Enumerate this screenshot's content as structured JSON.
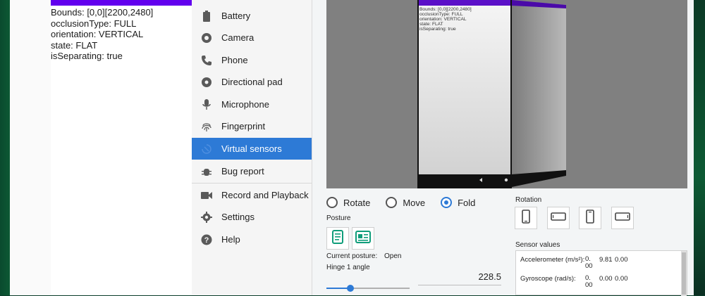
{
  "device_info": {
    "lines": [
      "Bounds: [0,0][2200,2480]",
      "occlusionType: FULL",
      "orientation: VERTICAL",
      "state: FLAT",
      "isSeparating: true"
    ]
  },
  "preview": {
    "lines": [
      "Bounds: [0,0][2200,2480]",
      "occlusionType: FULL",
      "orientation: VERTICAL",
      "state: FLAT",
      "isSeparating: true"
    ]
  },
  "nav": {
    "items": [
      {
        "label": "Battery",
        "icon": "battery-icon"
      },
      {
        "label": "Camera",
        "icon": "camera-icon"
      },
      {
        "label": "Phone",
        "icon": "phone-icon"
      },
      {
        "label": "Directional pad",
        "icon": "dpad-icon"
      },
      {
        "label": "Microphone",
        "icon": "microphone-icon"
      },
      {
        "label": "Fingerprint",
        "icon": "fingerprint-icon"
      },
      {
        "label": "Virtual sensors",
        "icon": "virtual-sensors-icon",
        "active": true
      },
      {
        "label": "Bug report",
        "icon": "bug-icon"
      },
      {
        "label": "Record and Playback",
        "icon": "video-icon"
      },
      {
        "label": "Settings",
        "icon": "gear-icon"
      },
      {
        "label": "Help",
        "icon": "help-icon"
      }
    ]
  },
  "mode": {
    "options": [
      "Rotate",
      "Move",
      "Fold"
    ],
    "selected": "Fold"
  },
  "posture": {
    "label": "Posture",
    "current_label": "Current posture:",
    "current_value": "Open"
  },
  "hinge": {
    "label": "Hinge 1 angle",
    "value": "228.5",
    "slider_fraction": 0.29
  },
  "rotation": {
    "label": "Rotation"
  },
  "sensors": {
    "label": "Sensor values",
    "rows": [
      {
        "name": "Accelerometer (m/s²):",
        "values": [
          "0.\n00",
          "9.81",
          "0.00"
        ]
      },
      {
        "name": "Gyroscope (rad/s):",
        "values": [
          "0.\n00",
          "0.00",
          "0.00"
        ]
      }
    ]
  },
  "colors": {
    "accent": "#2d7ad6",
    "purple_bar": "#6200ee",
    "posture_icon": "#0f9d7a"
  }
}
